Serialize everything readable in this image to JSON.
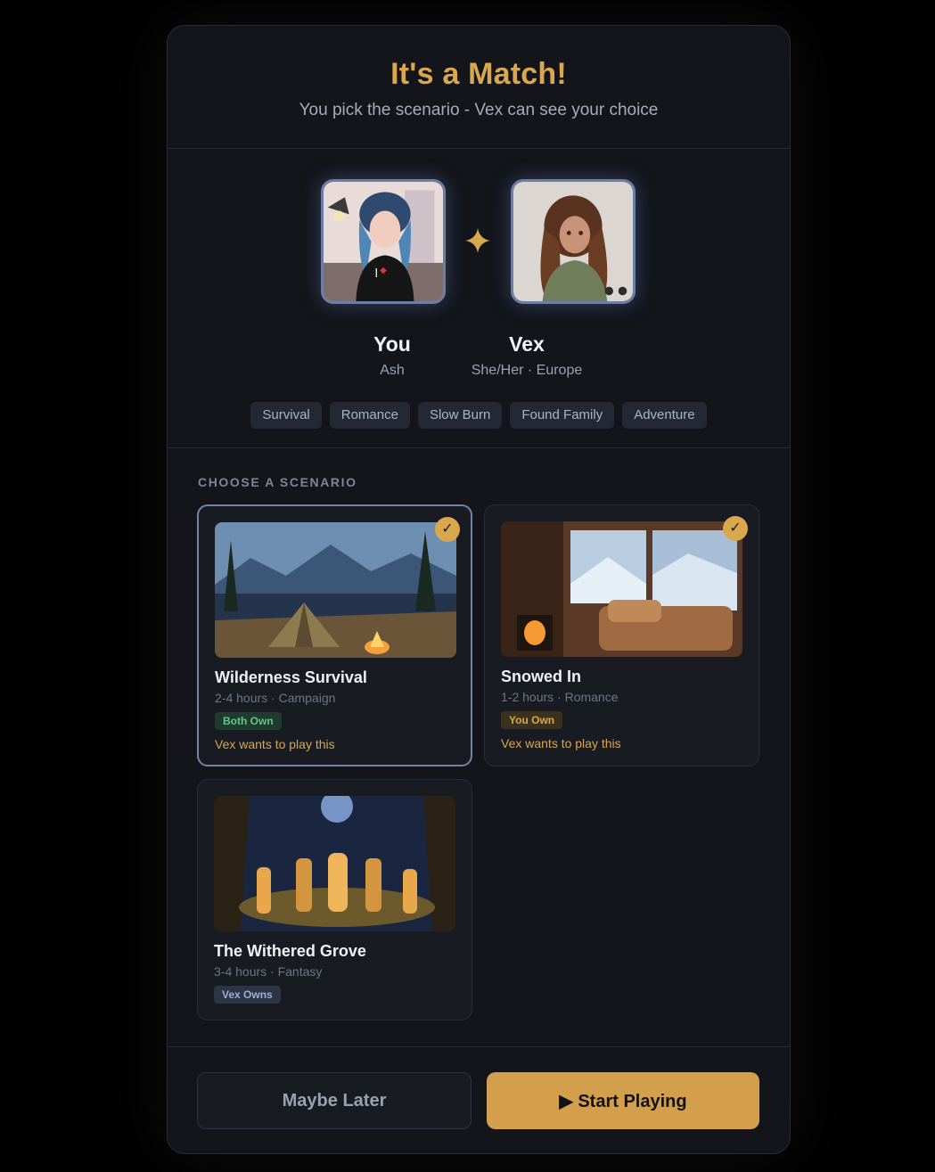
{
  "header": {
    "title": "It's a Match!",
    "subtitle": "You pick the scenario - Vex can see your choice"
  },
  "match": {
    "you": {
      "name": "You",
      "sub": "Ash"
    },
    "partner": {
      "name": "Vex",
      "sub": "She/Her · Europe"
    },
    "separator_icon": "sparkle-icon",
    "tags": [
      "Survival",
      "Romance",
      "Slow Burn",
      "Found Family",
      "Adventure"
    ]
  },
  "scenarios": {
    "label": "CHOOSE A SCENARIO",
    "items": [
      {
        "title": "Wilderness Survival",
        "meta": "2-4 hours · Campaign",
        "badge": "Both Own",
        "wants": "Vex wants to play this",
        "checked": true,
        "selected": true
      },
      {
        "title": "Snowed In",
        "meta": "1-2 hours · Romance",
        "badge": "You Own",
        "wants": "Vex wants to play this",
        "checked": true,
        "selected": false
      },
      {
        "title": "The Withered Grove",
        "meta": "3-4 hours · Fantasy",
        "badge": "Vex Owns",
        "wants": "",
        "checked": false,
        "selected": false
      }
    ],
    "check_glyph": "✓"
  },
  "footer": {
    "later_label": "Maybe Later",
    "start_label": "▶ Start Playing"
  },
  "colors": {
    "accent": "#d9a74c",
    "background": "#13151b",
    "selected_border": "#7483a8"
  }
}
